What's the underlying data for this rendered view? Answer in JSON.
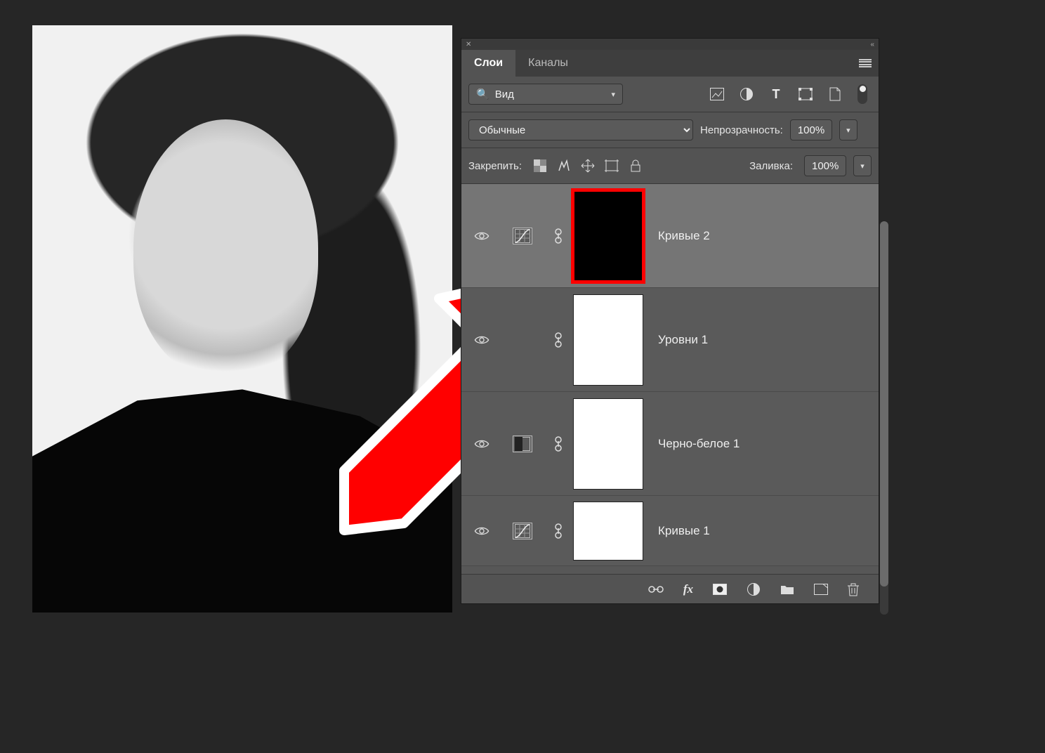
{
  "tabs": {
    "layers": "Слои",
    "channels": "Каналы"
  },
  "filter": {
    "value": "Вид",
    "search_icon": "search-icon"
  },
  "type_icons": [
    "image",
    "adjustment",
    "type",
    "shape",
    "smartobject"
  ],
  "blend": {
    "mode": "Обычные",
    "opacity_label": "Непрозрачность:",
    "opacity_value": "100%"
  },
  "lock": {
    "label": "Закрепить:",
    "fill_label": "Заливка:",
    "fill_value": "100%"
  },
  "layers": [
    {
      "name": "Кривые 2",
      "type": "curves",
      "mask": "black",
      "selected": true,
      "mask_selected": true
    },
    {
      "name": "Уровни 1",
      "type": "levels",
      "mask": "white",
      "selected": false,
      "mask_selected": false
    },
    {
      "name": "Черно-белое 1",
      "type": "blackwhite",
      "mask": "white",
      "selected": false,
      "mask_selected": false
    },
    {
      "name": "Кривые 1",
      "type": "curves",
      "mask": "white",
      "selected": false,
      "mask_selected": false
    }
  ],
  "bottom_icons": [
    "link",
    "fx",
    "mask",
    "adjustment",
    "group",
    "new",
    "trash"
  ]
}
